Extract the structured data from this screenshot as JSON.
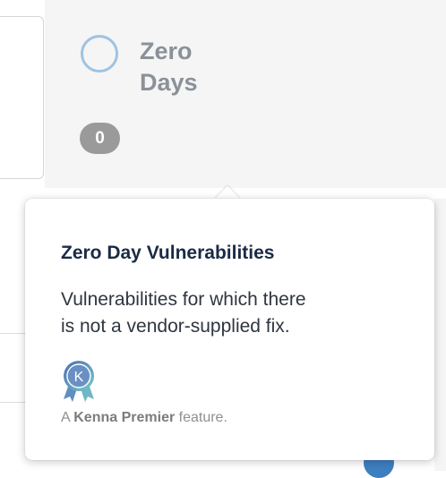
{
  "zero_days_card": {
    "title_line1": "Zero",
    "title_line2": "Days",
    "count": "0"
  },
  "tooltip": {
    "title": "Zero Day Vulnerabilities",
    "description_line1": "Vulnerabilities for which there",
    "description_line2": "is not a vendor-supplied fix.",
    "badge_icon": "kenna-premier-ribbon-icon",
    "badge_letter": "K",
    "footer_prefix": "A",
    "footer_brand": "Kenna Premier",
    "footer_suffix": "feature."
  },
  "colors": {
    "ring": "#9ec3e3",
    "card_background": "#f5f5f5",
    "count_badge": "#9a9a9a",
    "title_text": "#1a2b45",
    "badge_gradient_start": "#4b6fb3",
    "badge_gradient_end": "#7cc6c8"
  }
}
